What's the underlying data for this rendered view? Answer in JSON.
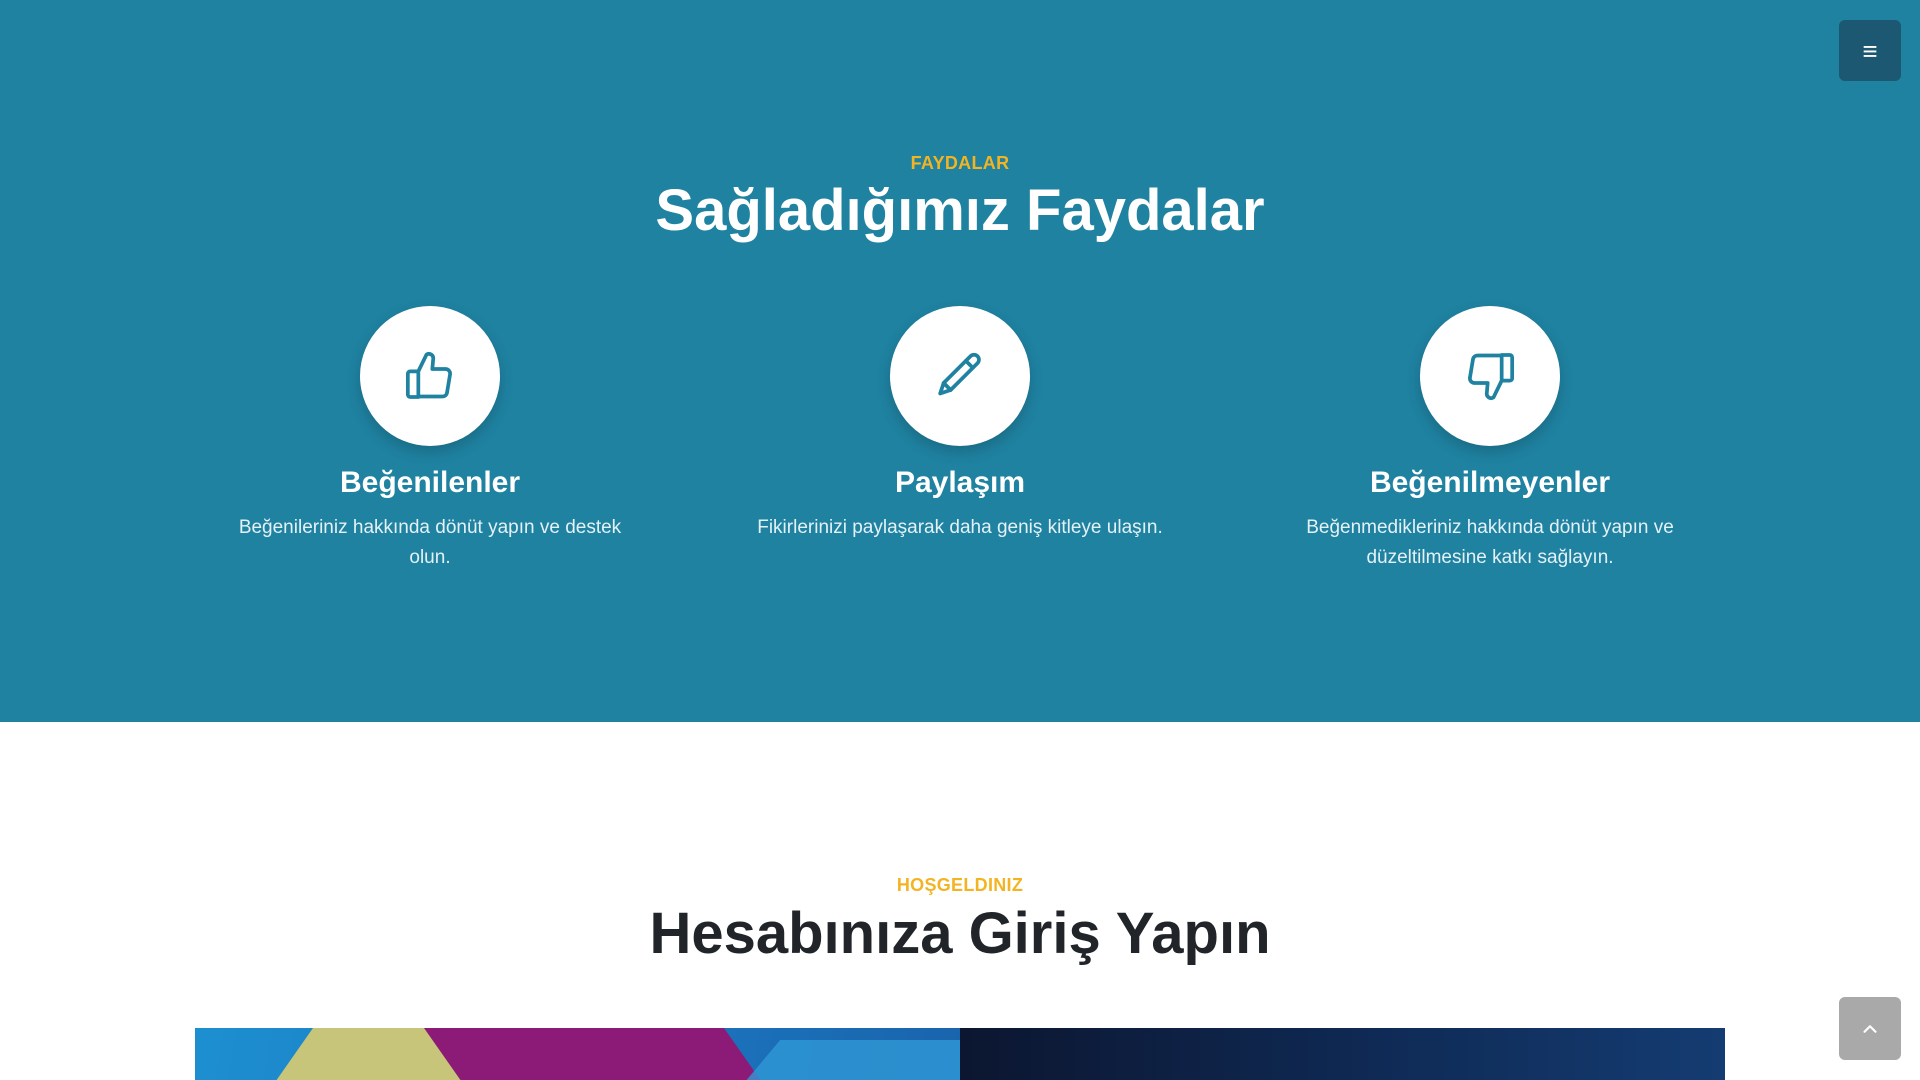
{
  "menu_button": {
    "icon": "hamburger-icon",
    "glyph": "≡"
  },
  "benefits": {
    "eyebrow": "FAYDALAR",
    "title": "Sağladığımız Faydalar",
    "items": [
      {
        "icon": "thumbs-up-icon",
        "title": "Beğenilenler",
        "desc": "Beğenileriniz hakkında dönüt yapın ve destek olun."
      },
      {
        "icon": "pencil-icon",
        "title": "Paylaşım",
        "desc": "Fikirlerinizi paylaşarak daha geniş kitleye ulaşın."
      },
      {
        "icon": "thumbs-down-icon",
        "title": "Beğenilmeyenler",
        "desc": "Beğenmedikleriniz hakkında dönüt yapın ve düzeltilmesine katkı sağlayın."
      }
    ]
  },
  "welcome": {
    "eyebrow": "HOŞGELDINIZ",
    "title": "Hesabınıza Giriş Yapın"
  },
  "scroll_top_button": {
    "icon": "chevron-up-icon"
  },
  "colors": {
    "primary": "#1f82a1",
    "accent": "#f2b422",
    "menu_button": "#1c5872",
    "scroll_button": "#a9a9a9",
    "heading_dark": "#212529"
  }
}
